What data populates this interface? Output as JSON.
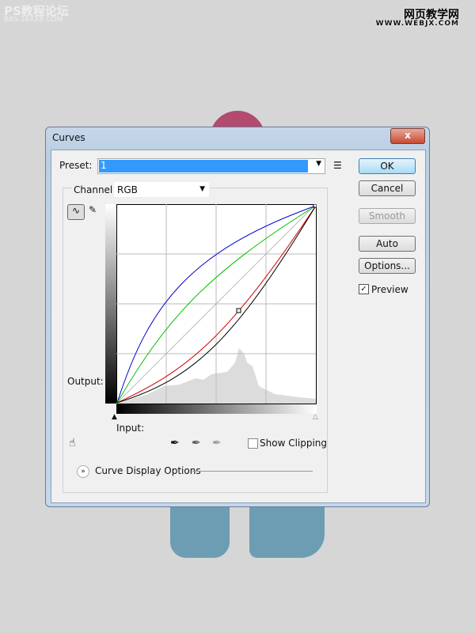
{
  "watermark": {
    "left_title": "PS教程论坛",
    "left_url": "BBS.16XX8.COM",
    "right_title": "网页教学网",
    "right_url": "WWW.WEBJX.COM"
  },
  "dialog": {
    "title": "Curves",
    "close": "x",
    "preset": {
      "label": "Preset:",
      "value": "1"
    },
    "channel": {
      "label": "Channel:",
      "value": "RGB"
    },
    "buttons": {
      "ok": "OK",
      "cancel": "Cancel",
      "smooth": "Smooth",
      "auto": "Auto",
      "options": "Options..."
    },
    "preview": {
      "label": "Preview",
      "checked": true
    },
    "output_label": "Output:",
    "input_label": "Input:",
    "show_clipping": {
      "label": "Show Clipping",
      "checked": false
    },
    "curve_display_options": "Curve Display Options",
    "curve_colors": {
      "rgb": "#000000",
      "red": "#d00000",
      "green": "#00c000",
      "blue": "#0000d0"
    }
  }
}
